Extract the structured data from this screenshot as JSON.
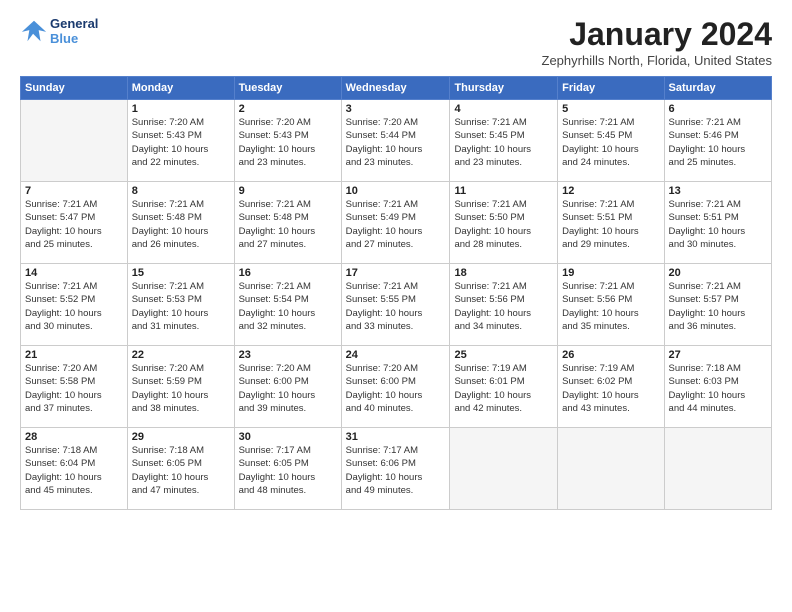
{
  "logo": {
    "line1": "General",
    "line2": "Blue"
  },
  "title": "January 2024",
  "subtitle": "Zephyrhills North, Florida, United States",
  "days_header": [
    "Sunday",
    "Monday",
    "Tuesday",
    "Wednesday",
    "Thursday",
    "Friday",
    "Saturday"
  ],
  "weeks": [
    [
      {
        "num": "",
        "info": ""
      },
      {
        "num": "1",
        "info": "Sunrise: 7:20 AM\nSunset: 5:43 PM\nDaylight: 10 hours\nand 22 minutes."
      },
      {
        "num": "2",
        "info": "Sunrise: 7:20 AM\nSunset: 5:43 PM\nDaylight: 10 hours\nand 23 minutes."
      },
      {
        "num": "3",
        "info": "Sunrise: 7:20 AM\nSunset: 5:44 PM\nDaylight: 10 hours\nand 23 minutes."
      },
      {
        "num": "4",
        "info": "Sunrise: 7:21 AM\nSunset: 5:45 PM\nDaylight: 10 hours\nand 23 minutes."
      },
      {
        "num": "5",
        "info": "Sunrise: 7:21 AM\nSunset: 5:45 PM\nDaylight: 10 hours\nand 24 minutes."
      },
      {
        "num": "6",
        "info": "Sunrise: 7:21 AM\nSunset: 5:46 PM\nDaylight: 10 hours\nand 25 minutes."
      }
    ],
    [
      {
        "num": "7",
        "info": "Sunrise: 7:21 AM\nSunset: 5:47 PM\nDaylight: 10 hours\nand 25 minutes."
      },
      {
        "num": "8",
        "info": "Sunrise: 7:21 AM\nSunset: 5:48 PM\nDaylight: 10 hours\nand 26 minutes."
      },
      {
        "num": "9",
        "info": "Sunrise: 7:21 AM\nSunset: 5:48 PM\nDaylight: 10 hours\nand 27 minutes."
      },
      {
        "num": "10",
        "info": "Sunrise: 7:21 AM\nSunset: 5:49 PM\nDaylight: 10 hours\nand 27 minutes."
      },
      {
        "num": "11",
        "info": "Sunrise: 7:21 AM\nSunset: 5:50 PM\nDaylight: 10 hours\nand 28 minutes."
      },
      {
        "num": "12",
        "info": "Sunrise: 7:21 AM\nSunset: 5:51 PM\nDaylight: 10 hours\nand 29 minutes."
      },
      {
        "num": "13",
        "info": "Sunrise: 7:21 AM\nSunset: 5:51 PM\nDaylight: 10 hours\nand 30 minutes."
      }
    ],
    [
      {
        "num": "14",
        "info": "Sunrise: 7:21 AM\nSunset: 5:52 PM\nDaylight: 10 hours\nand 30 minutes."
      },
      {
        "num": "15",
        "info": "Sunrise: 7:21 AM\nSunset: 5:53 PM\nDaylight: 10 hours\nand 31 minutes."
      },
      {
        "num": "16",
        "info": "Sunrise: 7:21 AM\nSunset: 5:54 PM\nDaylight: 10 hours\nand 32 minutes."
      },
      {
        "num": "17",
        "info": "Sunrise: 7:21 AM\nSunset: 5:55 PM\nDaylight: 10 hours\nand 33 minutes."
      },
      {
        "num": "18",
        "info": "Sunrise: 7:21 AM\nSunset: 5:56 PM\nDaylight: 10 hours\nand 34 minutes."
      },
      {
        "num": "19",
        "info": "Sunrise: 7:21 AM\nSunset: 5:56 PM\nDaylight: 10 hours\nand 35 minutes."
      },
      {
        "num": "20",
        "info": "Sunrise: 7:21 AM\nSunset: 5:57 PM\nDaylight: 10 hours\nand 36 minutes."
      }
    ],
    [
      {
        "num": "21",
        "info": "Sunrise: 7:20 AM\nSunset: 5:58 PM\nDaylight: 10 hours\nand 37 minutes."
      },
      {
        "num": "22",
        "info": "Sunrise: 7:20 AM\nSunset: 5:59 PM\nDaylight: 10 hours\nand 38 minutes."
      },
      {
        "num": "23",
        "info": "Sunrise: 7:20 AM\nSunset: 6:00 PM\nDaylight: 10 hours\nand 39 minutes."
      },
      {
        "num": "24",
        "info": "Sunrise: 7:20 AM\nSunset: 6:00 PM\nDaylight: 10 hours\nand 40 minutes."
      },
      {
        "num": "25",
        "info": "Sunrise: 7:19 AM\nSunset: 6:01 PM\nDaylight: 10 hours\nand 42 minutes."
      },
      {
        "num": "26",
        "info": "Sunrise: 7:19 AM\nSunset: 6:02 PM\nDaylight: 10 hours\nand 43 minutes."
      },
      {
        "num": "27",
        "info": "Sunrise: 7:18 AM\nSunset: 6:03 PM\nDaylight: 10 hours\nand 44 minutes."
      }
    ],
    [
      {
        "num": "28",
        "info": "Sunrise: 7:18 AM\nSunset: 6:04 PM\nDaylight: 10 hours\nand 45 minutes."
      },
      {
        "num": "29",
        "info": "Sunrise: 7:18 AM\nSunset: 6:05 PM\nDaylight: 10 hours\nand 47 minutes."
      },
      {
        "num": "30",
        "info": "Sunrise: 7:17 AM\nSunset: 6:05 PM\nDaylight: 10 hours\nand 48 minutes."
      },
      {
        "num": "31",
        "info": "Sunrise: 7:17 AM\nSunset: 6:06 PM\nDaylight: 10 hours\nand 49 minutes."
      },
      {
        "num": "",
        "info": ""
      },
      {
        "num": "",
        "info": ""
      },
      {
        "num": "",
        "info": ""
      }
    ]
  ]
}
